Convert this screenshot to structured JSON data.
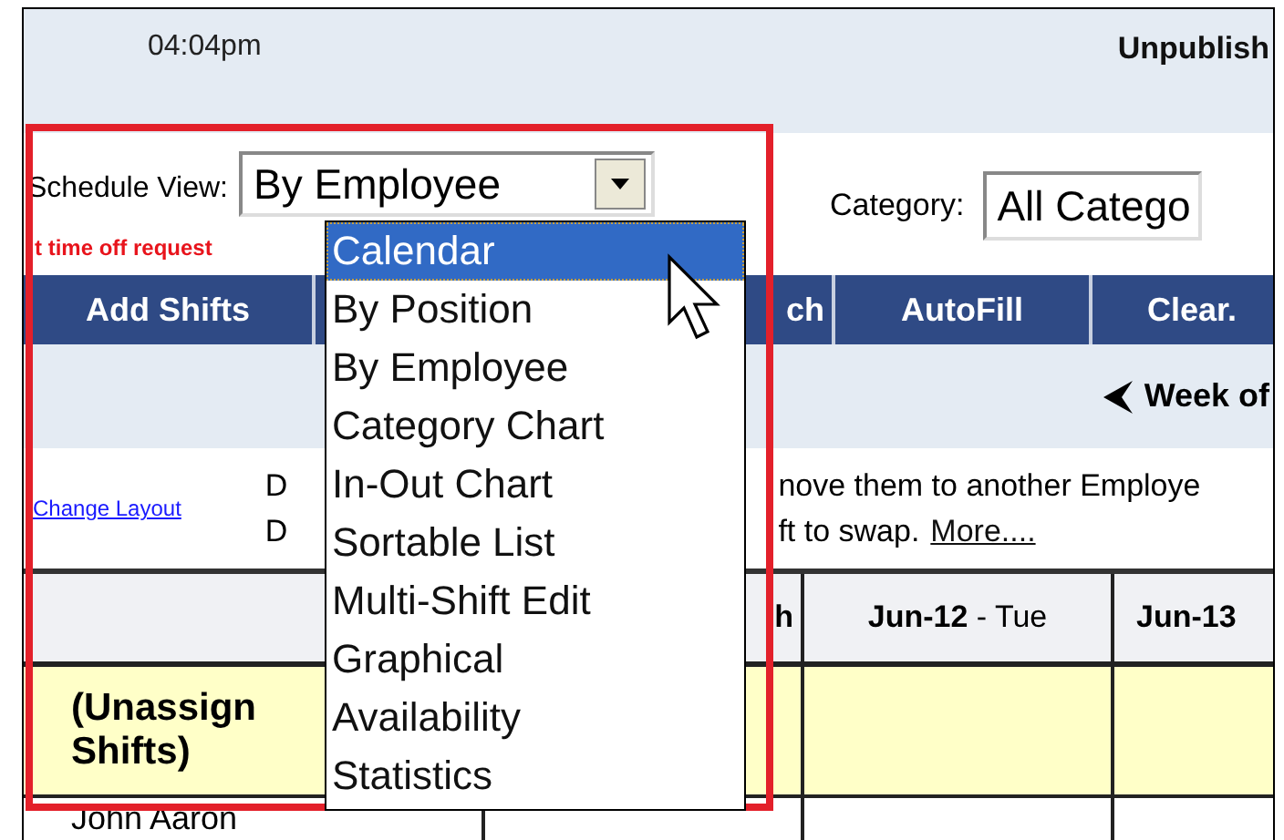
{
  "header": {
    "time": "04:04pm",
    "status": "Unpublish"
  },
  "schedule_view": {
    "label": "Schedule View:",
    "value": "By Employee",
    "options": [
      {
        "label": "Calendar",
        "highlighted": true
      },
      {
        "label": "By Position",
        "highlighted": false
      },
      {
        "label": "By Employee",
        "highlighted": false
      },
      {
        "label": "Category Chart",
        "highlighted": false
      },
      {
        "label": "In-Out Chart",
        "highlighted": false
      },
      {
        "label": "Sortable List",
        "highlighted": false
      },
      {
        "label": "Multi-Shift Edit",
        "highlighted": false
      },
      {
        "label": "Graphical",
        "highlighted": false
      },
      {
        "label": "Availability",
        "highlighted": false
      },
      {
        "label": "Statistics",
        "highlighted": false
      }
    ]
  },
  "category": {
    "label": "Category:",
    "value": "All Catego"
  },
  "alert": "t time off request",
  "toolbar": [
    {
      "label": "Add Shifts"
    },
    {
      "label": "ch"
    },
    {
      "label": "AutoFill"
    },
    {
      "label": "Clear."
    }
  ],
  "week_nav": {
    "label": "Week of"
  },
  "change_layout": "Change Layout",
  "notes": [
    {
      "start": "D",
      "rest": "nove them to another Employe"
    },
    {
      "start": "D",
      "rest": "ft to swap.",
      "link": "More...."
    }
  ],
  "table": {
    "columns": [
      "h",
      "**Jun-12** - Tue",
      "Jun-13"
    ],
    "rows": [
      {
        "kind": "unassigned",
        "lines": [
          "(Unassign",
          "Shifts)"
        ]
      },
      {
        "kind": "employee",
        "lines": [
          "John Aaron"
        ]
      }
    ]
  }
}
